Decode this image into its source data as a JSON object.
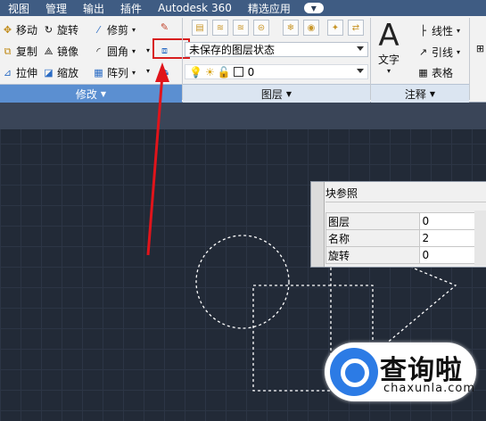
{
  "menu": [
    "视图",
    "管理",
    "输出",
    "插件",
    "Autodesk 360",
    "精选应用"
  ],
  "modify_panel": {
    "tools": [
      {
        "label": "移动",
        "icon": "move-icon"
      },
      {
        "label": "旋转",
        "icon": "rotate-icon"
      },
      {
        "label": "修剪",
        "icon": "trim-icon"
      },
      {
        "label": "复制",
        "icon": "copy-icon"
      },
      {
        "label": "镜像",
        "icon": "mirror-icon"
      },
      {
        "label": "圆角",
        "icon": "fillet-icon"
      },
      {
        "label": "拉伸",
        "icon": "stretch-icon"
      },
      {
        "label": "缩放",
        "icon": "scale-icon"
      },
      {
        "label": "阵列",
        "icon": "array-icon"
      }
    ],
    "title": "修改"
  },
  "layers_panel": {
    "state_dropdown": "未保存的图层状态",
    "layer_dropdown": "0",
    "title": "图层"
  },
  "annotation_panel": {
    "text_label": "文字",
    "linear_label": "线性",
    "leader_label": "引线",
    "table_label": "表格",
    "title": "注释"
  },
  "block_palette": {
    "title": "块参照",
    "rows": [
      {
        "key": "图层",
        "value": "0"
      },
      {
        "key": "名称",
        "value": "2"
      },
      {
        "key": "旋转",
        "value": "0"
      }
    ]
  },
  "watermark": {
    "big": "查询啦",
    "small": "chaxunla.com"
  },
  "colors": {
    "menu_bg": "#3f5c83",
    "canvas_bg": "#222a37",
    "annotation_red": "#e0141b",
    "highlight_box": "#d81e1e"
  }
}
